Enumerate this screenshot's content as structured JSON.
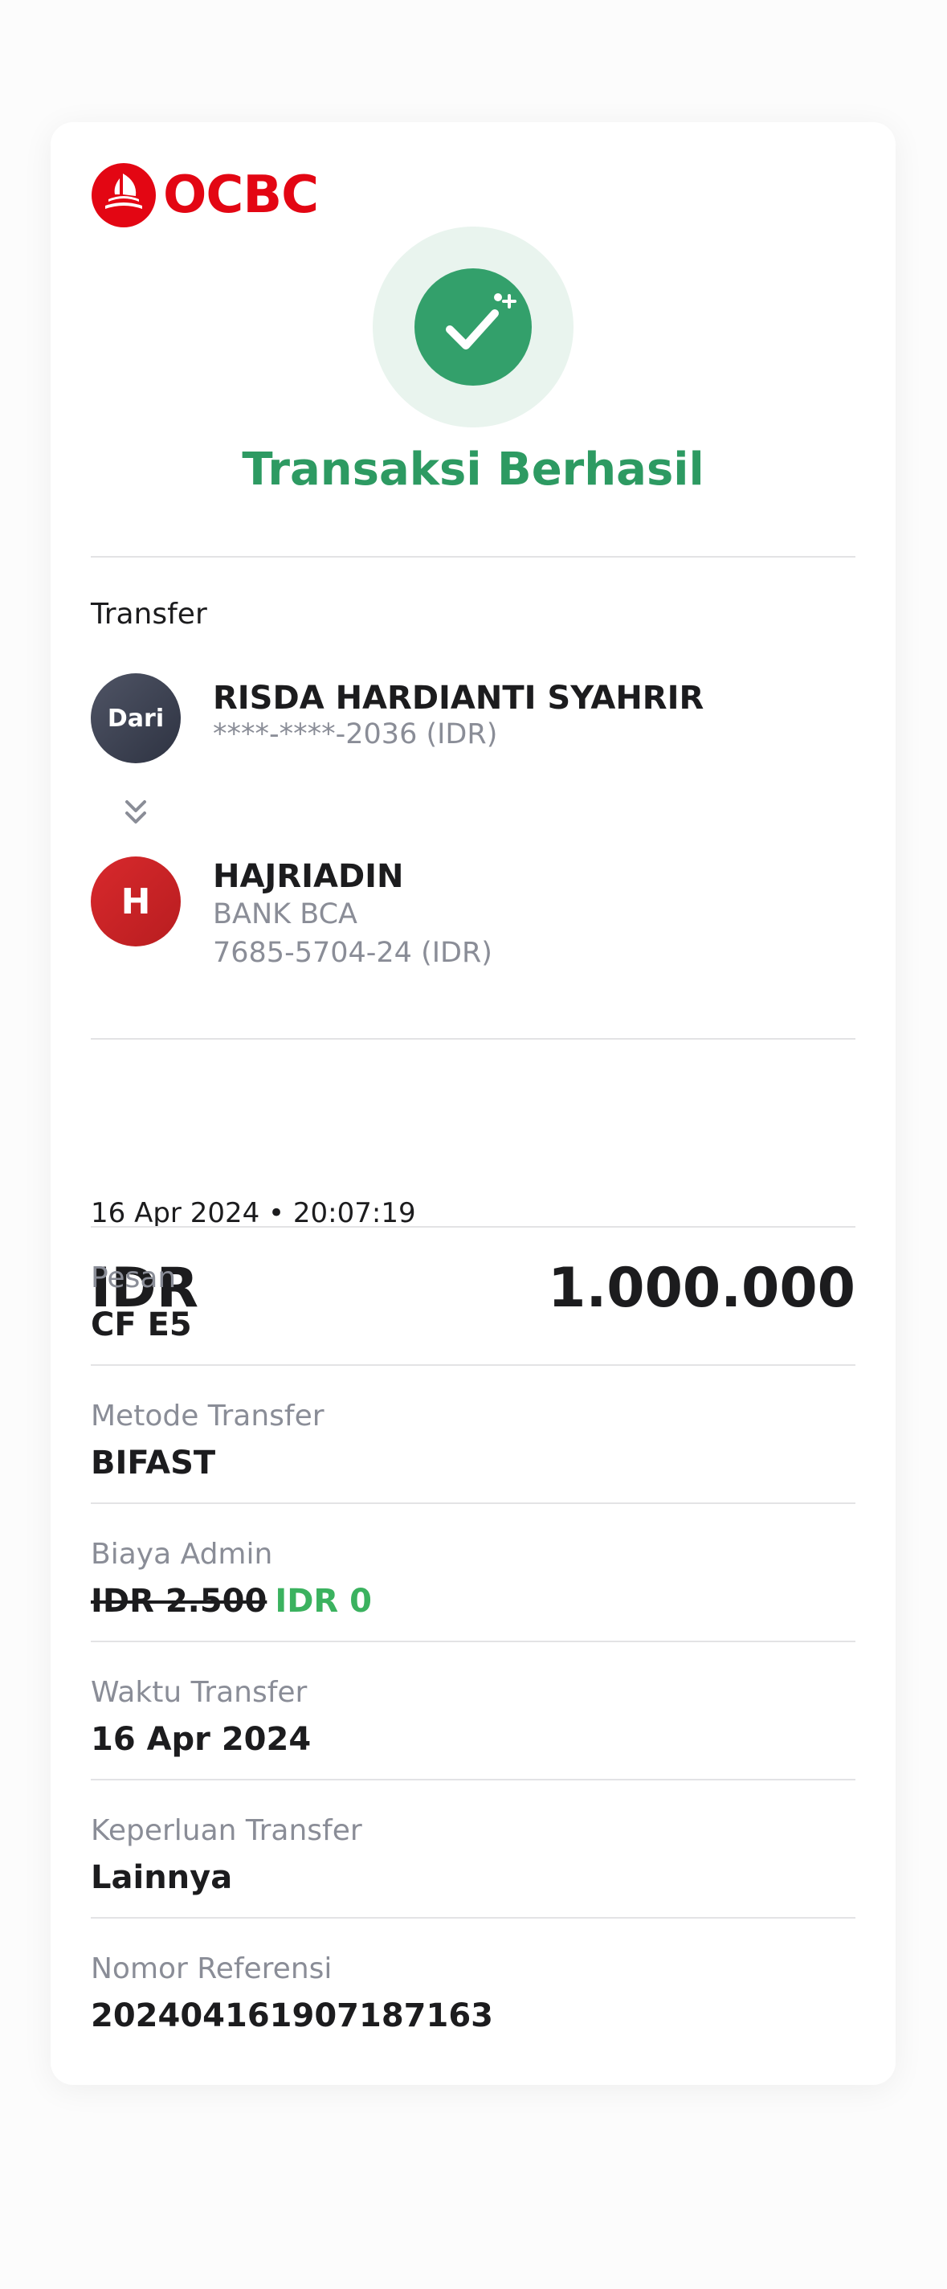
{
  "brand": {
    "name": "OCBC",
    "color": "#e30613",
    "logo_icon": "ocbc-sail-logo-icon"
  },
  "status": {
    "title": "Transaksi Berhasil",
    "icon": "check-sparkle-icon",
    "color": "#2d9a62"
  },
  "transfer": {
    "section_label": "Transfer",
    "from": {
      "avatar_label": "Dari",
      "name": "RISDA HARDIANTI SYAHRIR",
      "account": "****-****-2036 (IDR)"
    },
    "arrow_icon": "double-chevron-down-icon",
    "to": {
      "avatar_label": "H",
      "name": "HAJRIADIN",
      "bank": "BANK BCA",
      "account": "7685-5704-24 (IDR)"
    }
  },
  "summary": {
    "datetime": "16 Apr 2024 • 20:07:19",
    "currency": "IDR",
    "amount": "1.000.000"
  },
  "details": {
    "message_label": "Pesan",
    "message_value": "CF E5",
    "method_label": "Metode Transfer",
    "method_value": "BIFAST",
    "fee_label": "Biaya Admin",
    "fee_original": "IDR 2.500",
    "fee_actual": "IDR 0",
    "time_label": "Waktu Transfer",
    "time_value": "16 Apr 2024",
    "purpose_label": "Keperluan Transfer",
    "purpose_value": "Lainnya",
    "reference_label": "Nomor Referensi",
    "reference_value": "202404161907187163"
  }
}
